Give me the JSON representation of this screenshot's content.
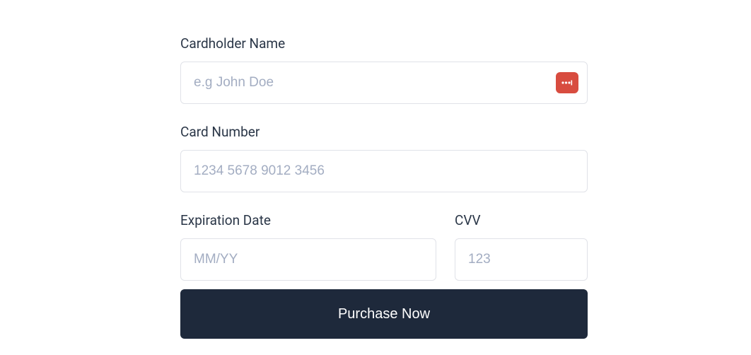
{
  "form": {
    "cardholder": {
      "label": "Cardholder Name",
      "placeholder": "e.g John Doe",
      "value": ""
    },
    "cardnumber": {
      "label": "Card Number",
      "placeholder": "1234 5678 9012 3456",
      "value": ""
    },
    "expiration": {
      "label": "Expiration Date",
      "placeholder": "MM/YY",
      "value": ""
    },
    "cvv": {
      "label": "CVV",
      "placeholder": "123",
      "value": ""
    },
    "submit_label": "Purchase Now"
  },
  "icons": {
    "autofill": "password-manager-icon"
  },
  "colors": {
    "label": "#2a3647",
    "placeholder": "#a3adc2",
    "border": "#e0e2e8",
    "button_bg": "#1e293b",
    "badge_bg": "#d84c3f"
  }
}
